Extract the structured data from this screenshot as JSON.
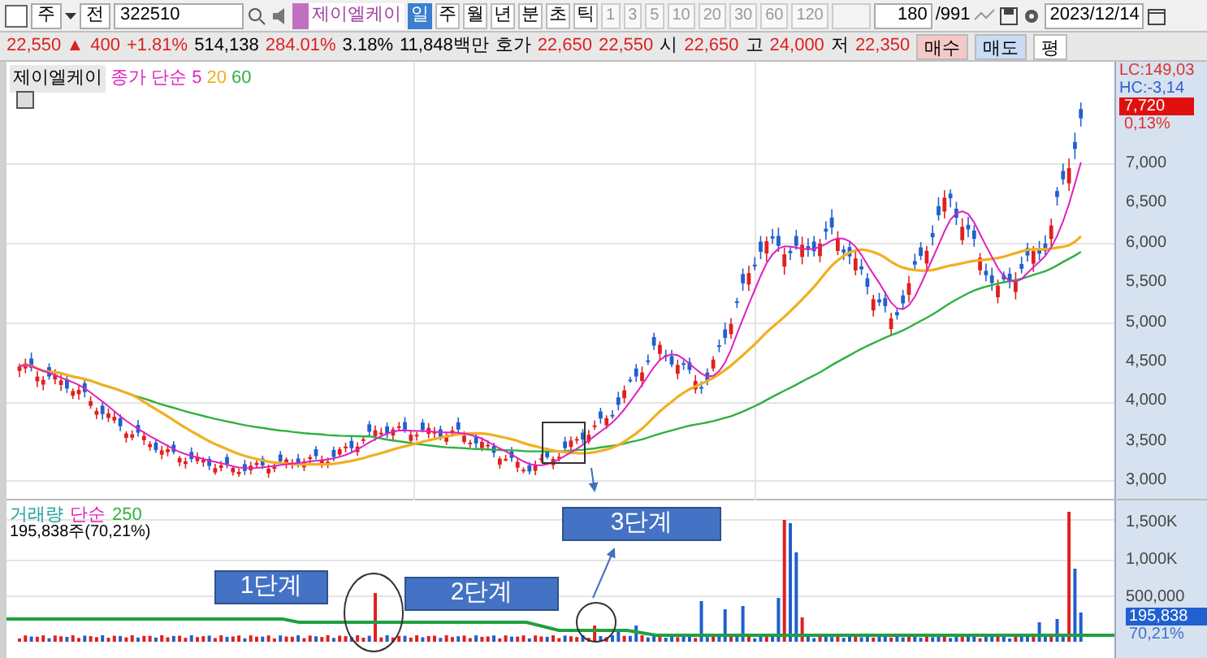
{
  "toolbar": {
    "market": "주",
    "board": "전",
    "code": "322510",
    "stock_name": "제이엘케이",
    "periods": [
      {
        "label": "일",
        "selected": true
      },
      {
        "label": "주",
        "selected": false
      },
      {
        "label": "월",
        "selected": false
      },
      {
        "label": "년",
        "selected": false
      },
      {
        "label": "분",
        "selected": false
      },
      {
        "label": "초",
        "selected": false
      },
      {
        "label": "틱",
        "selected": false
      }
    ],
    "intervals": [
      "1",
      "3",
      "5",
      "10",
      "20",
      "30",
      "60",
      "120"
    ],
    "count": "180",
    "total": "/991",
    "date": "2023/12/14"
  },
  "quote": {
    "cells": [
      {
        "text": "22,550 ▲",
        "kind": "up"
      },
      {
        "text": "400",
        "kind": "up"
      },
      {
        "text": "+1.81%",
        "kind": "up"
      },
      {
        "text": "514,138",
        "kind": "plain"
      },
      {
        "text": "284.01%",
        "kind": "up"
      },
      {
        "text": "3.18%",
        "kind": "plain"
      },
      {
        "text": "11,848백만",
        "kind": "plain"
      },
      {
        "text": "호가",
        "kind": "label"
      },
      {
        "text": "22,650",
        "kind": "up"
      },
      {
        "text": "22,550",
        "kind": "up"
      },
      {
        "text": "시",
        "kind": "label"
      },
      {
        "text": "22,650",
        "kind": "up"
      },
      {
        "text": "고",
        "kind": "label"
      },
      {
        "text": "24,000",
        "kind": "up"
      },
      {
        "text": "저",
        "kind": "label"
      },
      {
        "text": "22,350",
        "kind": "up"
      }
    ],
    "buttons": [
      {
        "label": "매수",
        "kind": "buy"
      },
      {
        "label": "매도",
        "kind": "sell"
      },
      {
        "label": "평",
        "kind": "plain"
      }
    ]
  },
  "price_panel": {
    "stock_label": "제이엘케이",
    "legend": [
      {
        "text": "종가 단순 5",
        "color": "#e020c0"
      },
      {
        "text": "20",
        "color": "#f0b020"
      },
      {
        "text": "60",
        "color": "#30b040"
      }
    ],
    "axis_top": [
      {
        "text": "LC:149,03",
        "color": "#e03030"
      },
      {
        "text": "HC:-3,14",
        "color": "#3060d0"
      }
    ],
    "current_price": "7,720",
    "current_change": "0,13%",
    "ticks": [
      "7,000",
      "6,500",
      "6,000",
      "5,500",
      "5,000",
      "4,500",
      "4,000",
      "3,500",
      "3,000"
    ]
  },
  "volume_panel": {
    "legend": [
      {
        "text": "거래량",
        "color": "#20a0a0"
      },
      {
        "text": "단순",
        "color": "#e020c0"
      },
      {
        "text": "250",
        "color": "#30b040"
      }
    ],
    "summary": "195,838주(70,21%)",
    "ticks": [
      "1,500K",
      "1,000K",
      "500,000"
    ],
    "current_volume": "195,838",
    "current_ratio": "70,21%"
  },
  "annotations": [
    "1단계",
    "2단계",
    "3단계"
  ]
}
